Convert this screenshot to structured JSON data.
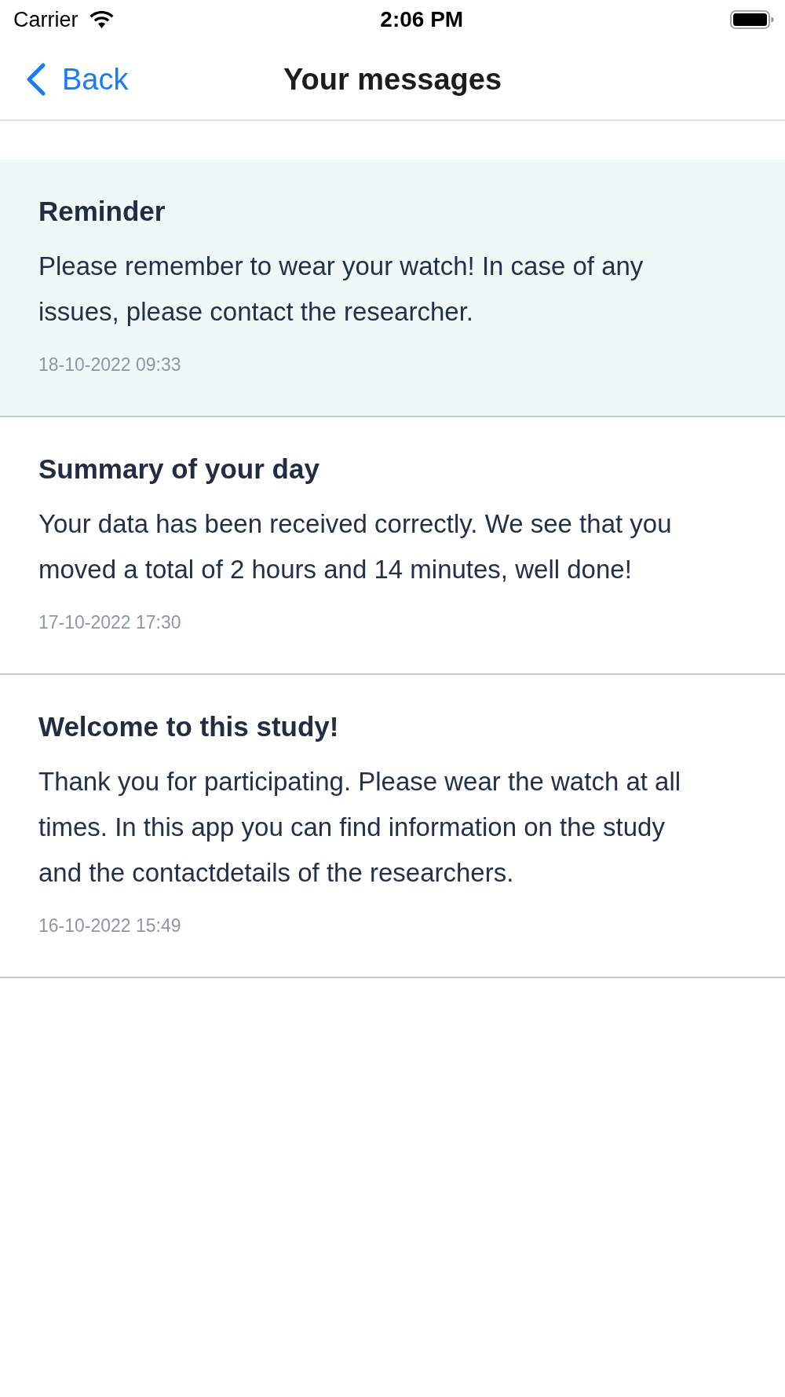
{
  "status_bar": {
    "carrier": "Carrier",
    "time": "2:06 PM"
  },
  "nav": {
    "back": "Back",
    "title": "Your messages"
  },
  "messages": [
    {
      "title": "Reminder",
      "body": "Please remember to wear your watch! In case of any issues, please contact the researcher.",
      "date": "18-10-2022 09:33",
      "unread": true
    },
    {
      "title": "Summary of your day",
      "body": "Your data has been received correctly. We see that you moved a total of 2 hours and 14 minutes, well done!",
      "date": "17-10-2022 17:30",
      "unread": false
    },
    {
      "title": "Welcome to this study!",
      "body": "Thank you for participating. Please wear the watch at all times. In this app you can find information on the study and the contactdetails of the researchers.",
      "date": "16-10-2022 15:49",
      "unread": false
    }
  ]
}
